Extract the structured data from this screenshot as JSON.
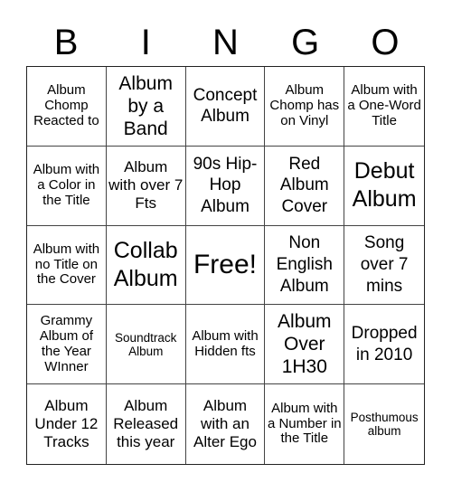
{
  "header": [
    "B",
    "I",
    "N",
    "G",
    "O"
  ],
  "cells": [
    "Album Chomp Reacted to",
    "Album by a Band",
    "Concept Album",
    "Album Chomp has on Vinyl",
    "Album with a One-Word Title",
    "Album with a Color in the Title",
    "Album with over 7 Fts",
    "90s Hip-Hop Album",
    "Red Album Cover",
    "Debut Album",
    "Album with no Title on the Cover",
    "Collab Album",
    "Free!",
    "Non English Album",
    "Song over 7 mins",
    "Grammy Album of the Year WInner",
    "Soundtrack Album",
    "Album with Hidden fts",
    "Album Over 1H30",
    "Dropped in 2010",
    "Album Under 12 Tracks",
    "Album Released this year",
    "Album with an Alter Ego",
    "Album with a Number in the Title",
    "Posthumous album"
  ]
}
